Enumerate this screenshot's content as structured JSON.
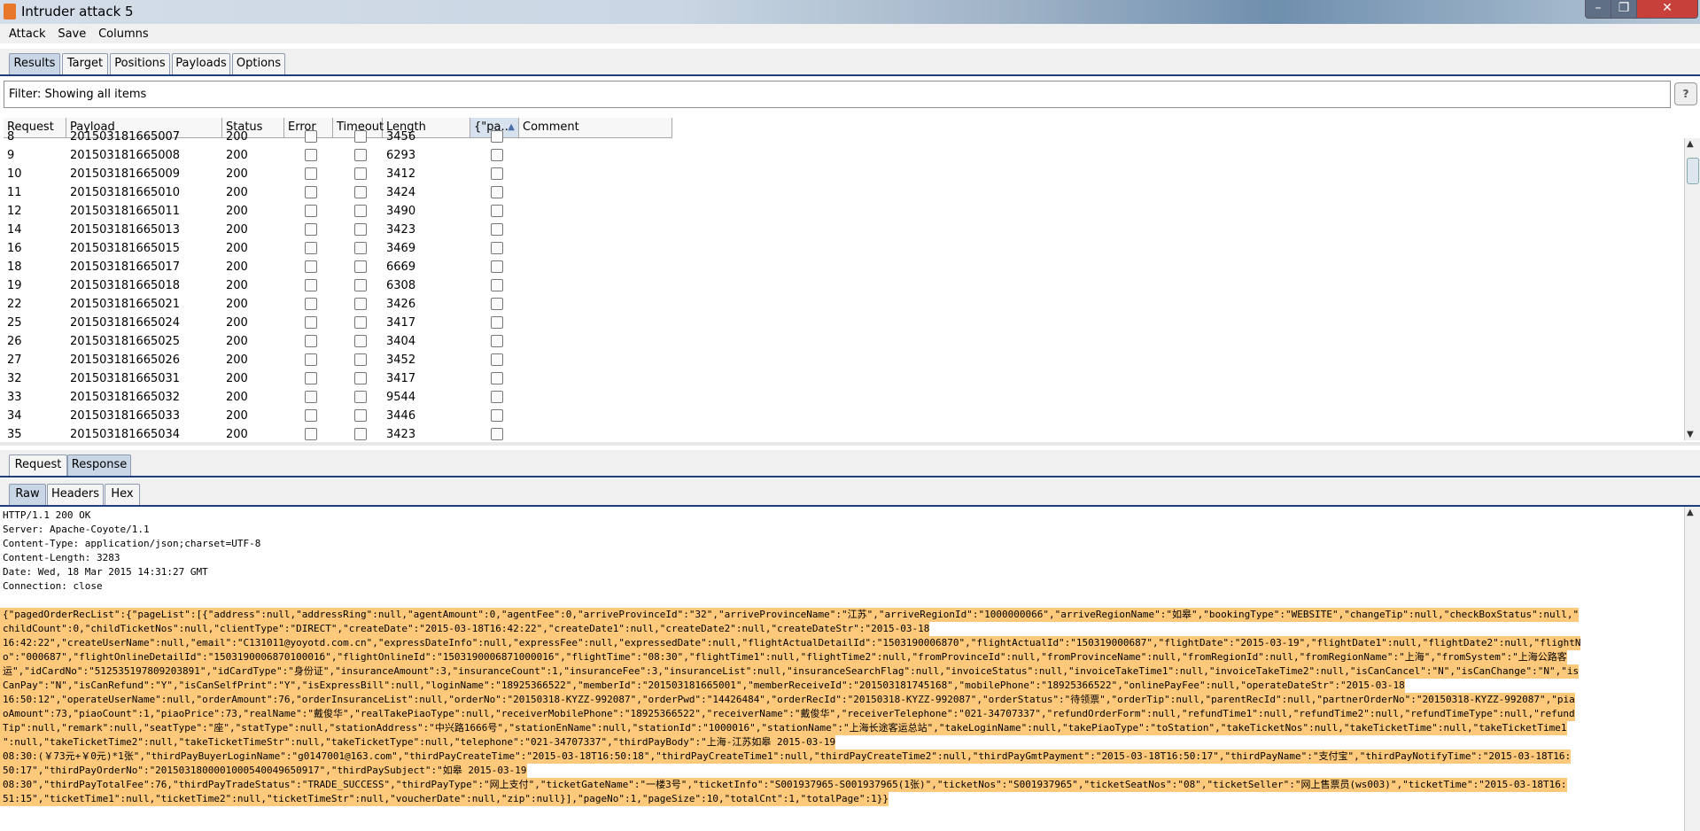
{
  "window": {
    "title": "Intruder attack 5",
    "minimize_glyph": "–",
    "maximize_glyph": "❐",
    "close_glyph": "✕"
  },
  "menu": [
    "Attack",
    "Save",
    "Columns"
  ],
  "main_tabs": [
    "Results",
    "Target",
    "Positions",
    "Payloads",
    "Options"
  ],
  "filter": {
    "text": "Filter: Showing all items",
    "help": "?"
  },
  "table": {
    "columns": [
      "Request",
      "Payload",
      "Status",
      "Error",
      "Timeout",
      "Length",
      "{\"pa...",
      "Comment"
    ],
    "sort_indicator": "▲",
    "partial_row": {
      "request": "8",
      "payload": "201503181665007",
      "status": "200",
      "length": "3456"
    },
    "rows": [
      {
        "request": "9",
        "payload": "201503181665008",
        "status": "200",
        "length": "6293"
      },
      {
        "request": "10",
        "payload": "201503181665009",
        "status": "200",
        "length": "3412"
      },
      {
        "request": "11",
        "payload": "201503181665010",
        "status": "200",
        "length": "3424"
      },
      {
        "request": "12",
        "payload": "201503181665011",
        "status": "200",
        "length": "3490"
      },
      {
        "request": "14",
        "payload": "201503181665013",
        "status": "200",
        "length": "3423"
      },
      {
        "request": "16",
        "payload": "201503181665015",
        "status": "200",
        "length": "3469"
      },
      {
        "request": "18",
        "payload": "201503181665017",
        "status": "200",
        "length": "6669"
      },
      {
        "request": "19",
        "payload": "201503181665018",
        "status": "200",
        "length": "6308"
      },
      {
        "request": "22",
        "payload": "201503181665021",
        "status": "200",
        "length": "3426"
      },
      {
        "request": "25",
        "payload": "201503181665024",
        "status": "200",
        "length": "3417"
      },
      {
        "request": "26",
        "payload": "201503181665025",
        "status": "200",
        "length": "3404"
      },
      {
        "request": "27",
        "payload": "201503181665026",
        "status": "200",
        "length": "3452"
      },
      {
        "request": "32",
        "payload": "201503181665031",
        "status": "200",
        "length": "3417"
      },
      {
        "request": "33",
        "payload": "201503181665032",
        "status": "200",
        "length": "9544"
      },
      {
        "request": "34",
        "payload": "201503181665033",
        "status": "200",
        "length": "3446"
      },
      {
        "request": "35",
        "payload": "201503181665034",
        "status": "200",
        "length": "3423"
      }
    ]
  },
  "reqresp_tabs": [
    "Request",
    "Response"
  ],
  "view_tabs": [
    "Raw",
    "Headers",
    "Hex"
  ],
  "response": {
    "headers": [
      "HTTP/1.1 200 OK",
      "Server: Apache-Coyote/1.1",
      "Content-Type: application/json;charset=UTF-8",
      "Content-Length: 3283",
      "Date: Wed, 18 Mar 2015 14:31:27 GMT",
      "Connection: close"
    ],
    "body_lines": [
      "{\"pagedOrderRecList\":{\"pageList\":[{\"address\":null,\"addressRing\":null,\"agentAmount\":0,\"agentFee\":0,\"arriveProvinceId\":\"32\",\"arriveProvinceName\":\"江苏\",\"arriveRegionId\":\"1000000066\",\"arriveRegionName\":\"如皋\",\"bookingType\":\"WEBSITE\",\"changeTip\":null,\"checkBoxStatus\":null,\"",
      "childCount\":0,\"childTicketNos\":null,\"clientType\":\"DIRECT\",\"createDate\":\"2015-03-18T16:42:22\",\"createDate1\":null,\"createDate2\":null,\"createDateStr\":\"2015-03-18",
      "16:42:22\",\"createUserName\":null,\"email\":\"C131011@yoyotd.com.cn\",\"expressDateInfo\":null,\"expressFee\":null,\"expressedDate\":null,\"flightActualDetailId\":\"1503190006870\",\"flightActualId\":\"150319000687\",\"flightDate\":\"2015-03-19\",\"flightDate1\":null,\"flightDate2\":null,\"flightN",
      "o\":\"000687\",\"flightOnlineDetailId\":\"150319000687010001б\",\"flightOnlineId\":\"1503190006871000016\",\"flightTime\":\"08:30\",\"flightTime1\":null,\"flightTime2\":null,\"fromProvinceId\":null,\"fromProvinceName\":null,\"fromRegionId\":null,\"fromRegionName\":\"上海\",\"fromSystem\":\"上海公路客",
      "运\",\"idCardNo\":\"512535197809203891\",\"idCardType\":\"身份证\",\"insuranceAmount\":3,\"insuranceCount\":1,\"insuranceFee\":3,\"insuranceList\":null,\"insuranceSearchFlag\":null,\"invoiceStatus\":null,\"invoiceTakeTime1\":null,\"invoiceTakeTime2\":null,\"isCanCancel\":\"N\",\"isCanChange\":\"N\",\"is",
      "CanPay\":\"N\",\"isCanRefund\":\"Y\",\"isCanSelfPrint\":\"Y\",\"isExpressBill\":null,\"loginName\":\"18925366522\",\"memberId\":\"201503181665001\",\"memberReceiveId\":\"201503181745168\",\"mobilePhone\":\"18925366522\",\"onlinePayFee\":null,\"operateDateStr\":\"2015-03-18",
      "16:50:12\",\"operateUserName\":null,\"orderAmount\":76,\"orderInsuranceList\":null,\"orderNo\":\"20150318-KYZZ-992087\",\"orderPwd\":\"14426484\",\"orderRecId\":\"20150318-KYZZ-992087\",\"orderStatus\":\"待领票\",\"orderTip\":null,\"parentRecId\":null,\"partnerOrderNo\":\"20150318-KYZZ-992087\",\"pia",
      "oAmount\":73,\"piaoCount\":1,\"piaoPrice\":73,\"realName\":\"戴俊华\",\"realTakePiaoType\":null,\"receiverMobilePhone\":\"18925366522\",\"receiverName\":\"戴俊华\",\"receiverTelephone\":\"021-34707337\",\"refundOrderForm\":null,\"refundTime1\":null,\"refundTime2\":null,\"refundTimeType\":null,\"refund",
      "Tip\":null,\"remark\":null,\"seatType\":\"座\",\"statType\":null,\"stationAddress\":\"中兴路1666号\",\"stationEnName\":null,\"stationId\":\"1000016\",\"stationName\":\"上海长途客运总站\",\"takeLoginName\":null,\"takePiaoType\":\"toStation\",\"takeTicketNos\":null,\"takeTicketTime\":null,\"takeTicketTime1",
      "\":null,\"takeTicketTime2\":null,\"takeTicketTimeStr\":null,\"takeTicketType\":null,\"telephone\":\"021-34707337\",\"thirdPayBody\":\"上海-江苏如皋 2015-03-19",
      "08:30:(￥73元+￥0元)*1张\",\"thirdPayBuyerLoginName\":\"g0147001@163.com\",\"thirdPayCreateTime\":\"2015-03-18T16:50:18\",\"thirdPayCreateTime1\":null,\"thirdPayCreateTime2\":null,\"thirdPayGmtPayment\":\"2015-03-18T16:50:17\",\"thirdPayName\":\"支付宝\",\"thirdPayNotifyTime\":\"2015-03-18T16:",
      "50:17\",\"thirdPayOrderNo\":\"2015031800001000540049650917\",\"thirdPaySubject\":\"如皋 2015-03-19",
      "08:30\",\"thirdPayTotalFee\":76,\"thirdPayTradeStatus\":\"TRADE_SUCCESS\",\"thirdPayType\":\"网上支付\",\"ticketGateName\":\"一楼3号\",\"ticketInfo\":\"S001937965-S001937965(1张)\",\"ticketNos\":\"S001937965\",\"ticketSeatNos\":\"08\",\"ticketSeller\":\"网上售票员(ws003)\",\"ticketTime\":\"2015-03-18T16:",
      "51:15\",\"ticketTime1\":null,\"ticketTime2\":null,\"ticketTimeStr\":null,\"voucherDate\":null,\"zip\":null}],\"pageNo\":1,\"pageSize\":10,\"totalCnt\":1,\"totalPage\":1}}"
    ]
  },
  "colors": {
    "accent": "#1f3e7a",
    "highlight": "#ffc97b",
    "selected_tab": "#c9d6e6"
  }
}
